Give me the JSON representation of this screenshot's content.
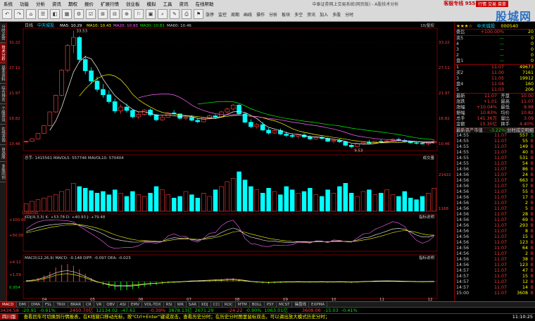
{
  "menu": {
    "items": [
      "系统",
      "功能",
      "分析",
      "资讯",
      "期权",
      "报价",
      "扩展行情",
      "创业板",
      "模拟",
      "工具",
      "资讯",
      "在线帮助"
    ],
    "window_title": "中泰证券网上交易系统(网页版) - A股技术分析",
    "hotline": "客服专线 95538",
    "trade_button": "行情 交易 菜单"
  },
  "toolbar": {
    "buttons": [
      "↶",
      "↷",
      "⌂",
      "☰",
      "◧",
      "▦",
      "⚙",
      "☑",
      "⊞",
      "⊟",
      "⊕",
      "⚐",
      "▣",
      "⌕",
      "✎",
      "⎙",
      "⚑"
    ],
    "texts": [
      "涨停",
      "监控",
      "周期",
      "画线",
      "操作",
      "分析",
      "板块",
      "多空",
      "资讯",
      "加入",
      "多股",
      "分时"
    ]
  },
  "logo": "股城网",
  "left_tabs": [
    "分时走势",
    "技术分析",
    "基本资料",
    "综合排名",
    "个股资讯",
    "在线咨询",
    "自选股",
    "多股同列"
  ],
  "left_tabs_active": 1,
  "chart": {
    "header": {
      "period": "日线",
      "name": "中天城投",
      "ma5": "MA5: 10.29",
      "ma10": "MA10: 10.43",
      "ma20": "MA20: 10.93",
      "ma30": "MA30: 10.81",
      "ma60": "MA60: 10.46",
      "right": "10/复权"
    },
    "price_axis": [
      "32.22",
      "27.11",
      "21.97",
      "16.82",
      "10.46"
    ],
    "price_axis_right": [
      "33.22",
      "27.11",
      "21.97",
      "16.82",
      "10.46"
    ],
    "labels": {
      "high": "33.53",
      "low": "9.53"
    },
    "volume": {
      "header": "总手: 1415561  MAVOL5: 557746  MAVOL10: 570404",
      "axis": [
        "21422",
        "1168"
      ],
      "axis_left": [
        "1168X100"
      ],
      "tab": "成交量"
    },
    "kdj": {
      "header": "KDJ(9,3,3) K: +53.78 D: +40.93 J: +79.48",
      "axis": [
        "+100.00",
        "+50.00"
      ],
      "tab": "指标说明"
    },
    "macd": {
      "header": "MACD(12,26,9)  MACD: -0.148  DIFF: -0.097  DEA: -0.023",
      "axis": [
        "+4.12",
        "+1.59",
        "0.954"
      ],
      "tab": "指标说明"
    },
    "x_ticks": [
      "04",
      "05",
      "06",
      "07",
      "08",
      "09",
      "10",
      "11",
      "12"
    ]
  },
  "chart_data": {
    "type": "candlestick",
    "title": "中天城投",
    "ylim": [
      9,
      34
    ],
    "candles": [
      [
        10.8,
        11.0,
        10.6,
        10.9
      ],
      [
        10.9,
        11.5,
        10.8,
        11.4
      ],
      [
        11.4,
        12.6,
        11.3,
        12.5
      ],
      [
        12.5,
        14.2,
        12.4,
        14.1
      ],
      [
        14.1,
        17.0,
        14.0,
        16.9
      ],
      [
        16.9,
        20.5,
        16.7,
        20.3
      ],
      [
        20.3,
        25.6,
        20.1,
        25.4
      ],
      [
        25.4,
        30.8,
        25.0,
        30.5
      ],
      [
        30.5,
        33.5,
        28.9,
        32.1
      ],
      [
        32.1,
        32.4,
        27.0,
        27.6
      ],
      [
        27.6,
        28.4,
        24.6,
        25.3
      ],
      [
        25.3,
        26.0,
        22.6,
        23.2
      ],
      [
        23.2,
        24.1,
        21.0,
        21.5
      ],
      [
        21.5,
        22.6,
        19.8,
        20.4
      ],
      [
        20.4,
        21.3,
        18.6,
        19.0
      ],
      [
        19.0,
        19.6,
        16.6,
        17.1
      ],
      [
        17.1,
        18.4,
        16.5,
        17.9
      ],
      [
        17.9,
        18.6,
        16.8,
        17.2
      ],
      [
        17.2,
        17.4,
        15.6,
        15.9
      ],
      [
        15.9,
        16.8,
        15.5,
        16.4
      ],
      [
        16.4,
        17.5,
        16.2,
        17.3
      ],
      [
        17.3,
        17.6,
        16.0,
        16.3
      ],
      [
        16.3,
        16.5,
        15.0,
        15.3
      ],
      [
        15.3,
        16.2,
        15.1,
        15.8
      ],
      [
        15.8,
        16.9,
        15.7,
        16.7
      ],
      [
        16.7,
        17.3,
        16.3,
        16.5
      ],
      [
        16.5,
        16.6,
        15.4,
        15.6
      ],
      [
        15.6,
        16.0,
        15.2,
        15.8
      ],
      [
        15.8,
        16.2,
        15.0,
        15.2
      ],
      [
        15.2,
        15.6,
        14.6,
        14.9
      ],
      [
        14.9,
        15.8,
        14.8,
        15.6
      ],
      [
        15.6,
        16.3,
        15.4,
        16.1
      ],
      [
        16.1,
        16.4,
        15.6,
        15.8
      ],
      [
        15.8,
        17.1,
        15.7,
        16.9
      ],
      [
        16.9,
        17.8,
        16.6,
        17.5
      ],
      [
        17.5,
        18.6,
        17.2,
        18.3
      ],
      [
        18.3,
        18.5,
        16.2,
        16.5
      ],
      [
        16.5,
        16.8,
        14.6,
        14.8
      ],
      [
        14.8,
        15.4,
        13.6,
        13.9
      ],
      [
        13.9,
        14.6,
        13.5,
        14.3
      ],
      [
        14.3,
        14.8,
        13.0,
        13.2
      ],
      [
        13.2,
        13.6,
        12.3,
        12.6
      ],
      [
        12.6,
        13.4,
        12.4,
        13.1
      ],
      [
        13.1,
        13.5,
        12.2,
        12.4
      ],
      [
        12.4,
        12.9,
        11.8,
        12.1
      ],
      [
        12.1,
        12.6,
        11.6,
        11.9
      ],
      [
        11.9,
        12.4,
        11.5,
        12.2
      ],
      [
        12.2,
        12.6,
        11.6,
        11.8
      ],
      [
        11.8,
        12.1,
        11.2,
        11.4
      ],
      [
        11.4,
        11.9,
        11.2,
        11.7
      ],
      [
        11.7,
        12.0,
        11.3,
        11.5
      ],
      [
        11.5,
        11.7,
        10.8,
        10.9
      ],
      [
        10.9,
        11.3,
        10.5,
        11.1
      ],
      [
        11.1,
        11.4,
        10.6,
        10.8
      ],
      [
        10.8,
        11.0,
        9.9,
        10.1
      ],
      [
        10.1,
        10.4,
        9.5,
        9.8
      ],
      [
        9.8,
        10.6,
        9.7,
        10.4
      ],
      [
        10.4,
        10.9,
        10.2,
        10.7
      ],
      [
        10.7,
        11.2,
        10.4,
        10.5
      ],
      [
        10.5,
        11.0,
        10.3,
        10.9
      ],
      [
        10.9,
        11.3,
        10.6,
        10.8
      ],
      [
        10.8,
        11.2,
        10.5,
        11.0
      ],
      [
        11.0,
        11.5,
        10.8,
        11.3
      ],
      [
        11.3,
        11.6,
        10.9,
        11.1
      ],
      [
        11.1,
        11.4,
        10.7,
        10.9
      ],
      [
        10.9,
        11.0,
        10.4,
        10.6
      ],
      [
        10.6,
        10.9,
        10.3,
        10.5
      ],
      [
        10.5,
        10.8,
        10.2,
        10.4
      ],
      [
        10.4,
        10.7,
        10.1,
        10.6
      ],
      [
        10.6,
        11.1,
        10.5,
        10.9
      ]
    ],
    "volume_ylim": [
      0,
      60000
    ],
    "volumes": [
      9000,
      12000,
      14000,
      16000,
      18000,
      20000,
      24000,
      26000,
      34000,
      30000,
      28000,
      25000,
      22000,
      24000,
      20000,
      26000,
      22000,
      18000,
      24000,
      20000,
      18000,
      22000,
      30000,
      26000,
      20000,
      16000,
      18000,
      24000,
      20000,
      16000,
      22000,
      18000,
      26000,
      30000,
      36000,
      40000,
      48000,
      38000,
      30000,
      26000,
      22000,
      28000,
      24000,
      20000,
      30000,
      26000,
      22000,
      24000,
      28000,
      20000,
      18000,
      26000,
      22000,
      30000,
      34000,
      22000,
      18000,
      24000,
      26000,
      20000,
      22000,
      26000,
      20000,
      18000,
      24000,
      16000,
      14000,
      18000,
      22000,
      28000
    ],
    "macd_ylim": [
      -0.8,
      1.2
    ],
    "macd": [
      0.05,
      0.1,
      0.2,
      0.35,
      0.55,
      0.8,
      0.95,
      1.0,
      0.9,
      0.7,
      0.45,
      0.2,
      -0.05,
      -0.2,
      -0.35,
      -0.45,
      -0.5,
      -0.48,
      -0.44,
      -0.38,
      -0.3,
      -0.24,
      -0.2,
      -0.15,
      -0.1,
      -0.08,
      -0.05,
      0.0,
      0.03,
      0.05,
      0.08,
      0.1,
      0.12,
      0.15,
      0.18,
      0.2,
      0.15,
      0.08,
      0.0,
      -0.06,
      -0.1,
      -0.12,
      -0.1,
      -0.08,
      -0.06,
      -0.05,
      -0.04,
      -0.05,
      -0.06,
      -0.05,
      -0.04,
      -0.06,
      -0.05,
      -0.04,
      -0.06,
      -0.08,
      -0.05,
      -0.02,
      0.0,
      0.02,
      0.03,
      0.04,
      0.03,
      0.02,
      0.01,
      0.0,
      -0.02,
      -0.03,
      -0.02,
      -0.01
    ]
  },
  "right_panel": {
    "stars": "★★★☆",
    "name": "中天城投",
    "code": "000540",
    "weibi": {
      "label": "委比",
      "value": "+100.00%",
      "value2": "20"
    },
    "sell": [
      {
        "label": "卖5",
        "price": "—",
        "vol": "0"
      },
      {
        "label": "4",
        "price": "—",
        "vol": "0"
      },
      {
        "label": "3",
        "price": "—",
        "vol": "0"
      },
      {
        "label": "2",
        "price": "—",
        "vol": "0"
      },
      {
        "label": "盘1",
        "price": "—",
        "vol": "0"
      }
    ],
    "buy": [
      {
        "label": "1",
        "price": "11.07",
        "vol": "49673"
      },
      {
        "label": "买2",
        "price": "11.00",
        "vol": "7161"
      },
      {
        "label": "3",
        "price": "11.05",
        "vol": "19912"
      },
      {
        "label": "盘4",
        "price": "11.04",
        "vol": "160"
      },
      {
        "label": "5",
        "price": "11.03",
        "vol": "206"
      }
    ],
    "quote": [
      {
        "l1": "最新",
        "v1": "11.07",
        "l2": "开盘",
        "v2": "10.00"
      },
      {
        "l1": "涨跌",
        "v1": "+1.01",
        "l2": "最高",
        "v2": "11.07"
      },
      {
        "l1": "涨幅",
        "v1": "+10.04%",
        "l2": "最低",
        "v2": "9.98"
      },
      {
        "l1": "振幅",
        "v1": "10.83%",
        "l2": "均价",
        "v2": "10.82"
      },
      {
        "l1": "总手",
        "v1": "141.36万",
        "l2": "量比",
        "v2": "3.09"
      },
      {
        "l1": "金额",
        "v1": "15.30亿",
        "l2": "换手",
        "v2": "4.40%"
      }
    ],
    "tick_header": {
      "left": "最新资产市值",
      "mid": "-3.22%",
      "btn": "分时成交明细"
    },
    "ticks": [
      {
        "t": "14:55",
        "p": "11.07",
        "v": "557",
        "f": "S"
      },
      {
        "t": "14:55",
        "p": "11.07",
        "v": "55",
        "f": "B"
      },
      {
        "t": "14:55",
        "p": "11.07",
        "v": "149",
        "f": "B"
      },
      {
        "t": "14:55",
        "p": "11.07",
        "v": "40",
        "f": "B"
      },
      {
        "t": "14:55",
        "p": "11.07",
        "v": "531",
        "f": "B"
      },
      {
        "t": "14:55",
        "p": "11.07",
        "v": "54",
        "f": "B"
      },
      {
        "t": "14:56",
        "p": "11.07",
        "v": "86",
        "f": "B"
      },
      {
        "t": "14:56",
        "p": "11.07",
        "v": "24",
        "f": "B"
      },
      {
        "t": "14:56",
        "p": "11.07",
        "v": "663",
        "f": "B"
      },
      {
        "t": "14:56",
        "p": "11.07",
        "v": "57",
        "f": "B"
      },
      {
        "t": "14:56",
        "p": "11.07",
        "v": "55",
        "f": "B"
      },
      {
        "t": "14:56",
        "p": "11.07",
        "v": "17",
        "f": "B"
      },
      {
        "t": "14:56",
        "p": "11.07",
        "v": "2",
        "f": "B"
      },
      {
        "t": "14:56",
        "p": "11.07",
        "v": "5",
        "f": "B"
      },
      {
        "t": "14:56",
        "p": "11.07",
        "v": "28",
        "f": "B"
      },
      {
        "t": "14:56",
        "p": "11.07",
        "v": "69",
        "f": "B"
      },
      {
        "t": "14:56",
        "p": "11.07",
        "v": "293",
        "f": "B"
      },
      {
        "t": "14:56",
        "p": "11.07",
        "v": "8",
        "f": "B"
      },
      {
        "t": "14:56",
        "p": "11.07",
        "v": "15",
        "f": "B"
      },
      {
        "t": "14:56",
        "p": "11.07",
        "v": "123",
        "f": "B"
      },
      {
        "t": "14:56",
        "p": "11.07",
        "v": "64",
        "f": "B"
      },
      {
        "t": "14:56",
        "p": "11.07",
        "v": "2",
        "f": "B"
      },
      {
        "t": "14:56",
        "p": "11.07",
        "v": "38",
        "f": "B"
      },
      {
        "t": "14:56",
        "p": "11.07",
        "v": "123",
        "f": "B"
      },
      {
        "t": "14:57",
        "p": "11.07",
        "v": "47",
        "f": "B"
      },
      {
        "t": "14:57",
        "p": "11.07",
        "v": "15",
        "f": "B"
      },
      {
        "t": "14:57",
        "p": "11.07",
        "v": "12",
        "f": "B"
      },
      {
        "t": "14:57",
        "p": "11.07",
        "v": "14",
        "f": "B"
      },
      {
        "t": "15:00",
        "p": "11.07",
        "v": "3608",
        "f": "B"
      }
    ]
  },
  "bottom": {
    "tabs": [
      "MACD",
      "DMI",
      "DMA",
      "FSL",
      "TRIX",
      "BRAR",
      "CR",
      "VR",
      "OBV",
      "ASI",
      "EMV",
      "VOL-TDX",
      "RSI",
      "WR",
      "SAR",
      "KDJ",
      "CCI",
      "ROC",
      "MTM",
      "BOLL",
      "PSY",
      "MCST",
      "操盘线",
      "EXPMA"
    ],
    "tab_active": 0,
    "index": [
      {
        "name": "3434.58",
        "v": "-20.91",
        "p": "-0.61%"
      },
      {
        "name": "2450.70亿",
        "v": "12134.02",
        "p": "-47.61"
      },
      {
        "name": "-0.39%",
        "v": "3878.13亿",
        "p": "2671.29"
      },
      {
        "name": "-24.22",
        "v": "-0.90%",
        "p": "1063.01亿"
      },
      {
        "name": "3608.06",
        "v": "-15.03",
        "p": "-0.41%"
      }
    ],
    "sys": "四川版",
    "marquee": "查看回车可切换到行情报表，在K线窗口移动光标，按\"Ctrl+Enter\"键或双击，查看历史分时；在历史分时图里鼠标双击，可以调出放大模式历史分时；",
    "clock": "11:10:25"
  }
}
